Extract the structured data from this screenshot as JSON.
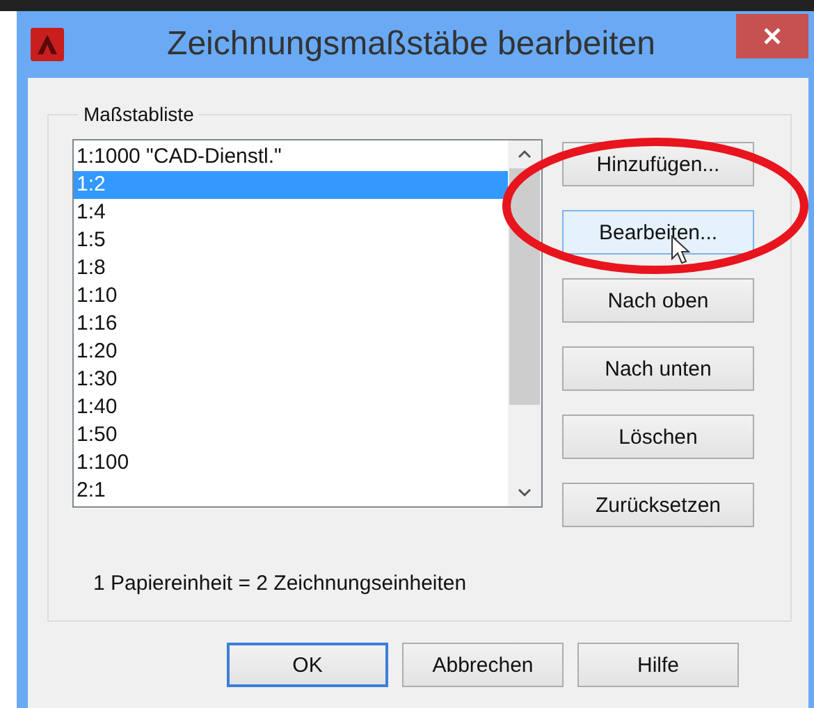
{
  "window": {
    "title": "Zeichnungsmaßstäbe bearbeiten"
  },
  "group": {
    "title": "Maßstabliste"
  },
  "scale_list": [
    {
      "label": "1:1000 \"CAD-Dienstl.\"",
      "selected": false
    },
    {
      "label": "1:2",
      "selected": true
    },
    {
      "label": "1:4",
      "selected": false
    },
    {
      "label": "1:5",
      "selected": false
    },
    {
      "label": "1:8",
      "selected": false
    },
    {
      "label": "1:10",
      "selected": false
    },
    {
      "label": "1:16",
      "selected": false
    },
    {
      "label": "1:20",
      "selected": false
    },
    {
      "label": "1:30",
      "selected": false
    },
    {
      "label": "1:40",
      "selected": false
    },
    {
      "label": "1:50",
      "selected": false
    },
    {
      "label": "1:100",
      "selected": false
    },
    {
      "label": "2:1",
      "selected": false
    }
  ],
  "side_buttons": [
    {
      "label": "Hinzufügen...",
      "hovered": false
    },
    {
      "label": "Bearbeiten...",
      "hovered": true
    },
    {
      "label": "Nach oben",
      "hovered": false
    },
    {
      "label": "Nach unten",
      "hovered": false
    },
    {
      "label": "Löschen",
      "hovered": false
    },
    {
      "label": "Zurücksetzen",
      "hovered": false
    }
  ],
  "info": "1 Papiereinheit = 2 Zeichnungseinheiten",
  "footer_buttons": [
    {
      "label": "OK",
      "default": true
    },
    {
      "label": "Abbrechen",
      "default": false
    },
    {
      "label": "Hilfe",
      "default": false
    }
  ]
}
